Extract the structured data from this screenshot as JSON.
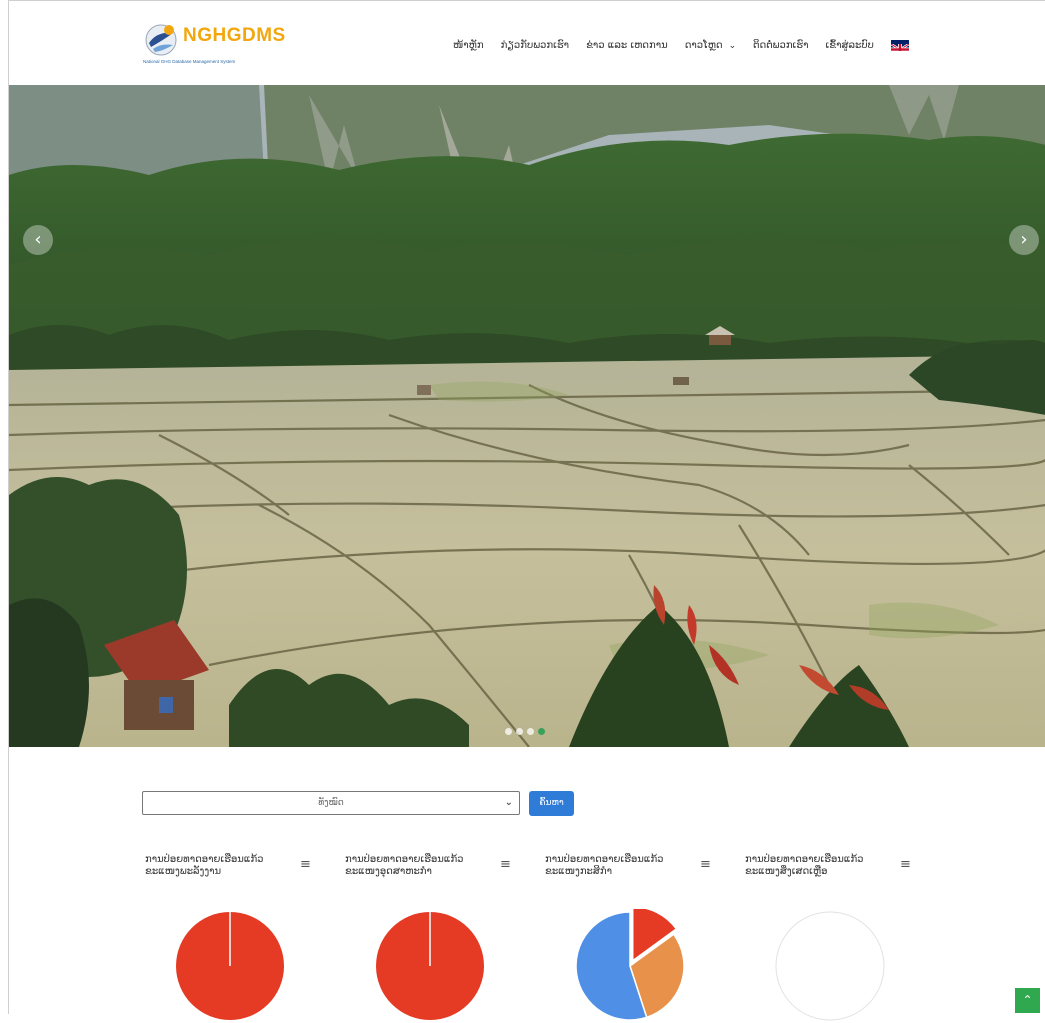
{
  "header": {
    "logo_text": "NGHGDMS",
    "logo_tagline": "National GHG Database Management System",
    "nav": [
      {
        "label": "ໜ້າຫຼັກ"
      },
      {
        "label": "ກ່ຽວກັບພວກເຮົາ"
      },
      {
        "label": "ຂ່າວ ແລະ ເຫດການ"
      },
      {
        "label": "ດາວໂຫຼດ",
        "has_dropdown": true
      },
      {
        "label": "ຕິດຕໍ່ພວກເຮົາ"
      },
      {
        "label": "ເຂົ້າສູ່ລະບົບ"
      }
    ],
    "language_flag": "uk-flag"
  },
  "hero": {
    "slides": 4,
    "active_slide": 4
  },
  "filter": {
    "selected": "ທັງໝົດ",
    "search_label": "ຄົ້ນຫາ"
  },
  "charts": [
    {
      "title": "ການປ່ອຍທາດອາຍເຮືອນແກ້ວ ຂະແໜງພະລັງງານ",
      "slices": [
        {
          "value": 100,
          "color": "#e53b25"
        }
      ]
    },
    {
      "title": "ການປ່ອຍທາດອາຍເຮືອນແກ້ວ ຂະແໜງອຸດສາຫະກໍາ",
      "slices": [
        {
          "value": 100,
          "color": "#e53b25"
        }
      ]
    },
    {
      "title": "ການປ່ອຍທາດອາຍເຮືອນແກ້ວ ຂະແໜງກະສິກໍາ",
      "slices": [
        {
          "value": 15,
          "color": "#e53b25",
          "exploded": true
        },
        {
          "value": 30,
          "color": "#e8914b"
        },
        {
          "value": 55,
          "color": "#4f8fe6"
        }
      ]
    },
    {
      "title": "ການປ່ອຍທາດອາຍເຮືອນແກ້ວ ຂະແໜງສິ່ງເສດເຫຼືອ",
      "slices": []
    }
  ],
  "colors": {
    "accent": "#2f7bd8",
    "scroll_top": "#2fa84f",
    "logo": "#f2a70f"
  },
  "icons": {
    "scroll_top": "chevron-up-icon",
    "menu": "hamburger-icon"
  }
}
